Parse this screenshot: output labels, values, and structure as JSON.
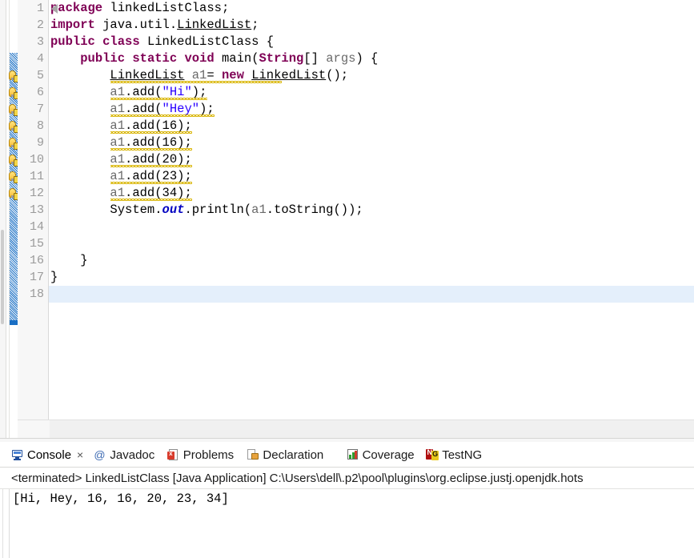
{
  "editor": {
    "first_line": 1,
    "last_line": 18,
    "current_line": 18,
    "line_numbers": [
      "1",
      "2",
      "3",
      "4",
      "5",
      "6",
      "7",
      "8",
      "9",
      "10",
      "11",
      "12",
      "13",
      "14",
      "15",
      "16",
      "17",
      "18"
    ],
    "fold_marker_line": 4,
    "fold_marker_icon": "collapse-minus-icon",
    "change_bar_color": "#1a6fc4",
    "warning_icon": "warning-lightbulb-icon",
    "warning_lines": [
      5,
      6,
      7,
      8,
      9,
      10,
      11,
      12
    ],
    "lines": [
      {
        "n": 1,
        "code": "package linkedListClass;"
      },
      {
        "n": 2,
        "code": "import java.util.LinkedList;"
      },
      {
        "n": 3,
        "code": "public class LinkedListClass {"
      },
      {
        "n": 4,
        "code": "    public static void main(String[] args) {"
      },
      {
        "n": 5,
        "code": "        LinkedList a1= new LinkedList();"
      },
      {
        "n": 6,
        "code": "        a1.add(\"Hi\");"
      },
      {
        "n": 7,
        "code": "        a1.add(\"Hey\");"
      },
      {
        "n": 8,
        "code": "        a1.add(16);"
      },
      {
        "n": 9,
        "code": "        a1.add(16);"
      },
      {
        "n": 10,
        "code": "        a1.add(20);"
      },
      {
        "n": 11,
        "code": "        a1.add(23);"
      },
      {
        "n": 12,
        "code": "        a1.add(34);"
      },
      {
        "n": 13,
        "code": "        System.out.println(a1.toString());"
      },
      {
        "n": 14,
        "code": ""
      },
      {
        "n": 15,
        "code": ""
      },
      {
        "n": 16,
        "code": "    }"
      },
      {
        "n": 17,
        "code": "}"
      },
      {
        "n": 18,
        "code": ""
      }
    ],
    "syntax_colors": {
      "keyword": "#7f0055",
      "string": "#2a00ff",
      "local_variable": "#6a6a6a",
      "static_field": "#0000c0",
      "plain": "#000000",
      "warning_squiggle": "#d8b400",
      "current_line_highlight": "#e4effb"
    },
    "scroll_left_arrow": "scroll-left-arrow-icon"
  },
  "console_view": {
    "tabs": [
      {
        "label": "Console",
        "icon": "console-monitor-icon",
        "active": true,
        "closable": true
      },
      {
        "label": "Javadoc",
        "icon": "javadoc-at-icon",
        "active": false,
        "closable": false
      },
      {
        "label": "Problems",
        "icon": "problems-error-icon",
        "active": false,
        "closable": false
      },
      {
        "label": "Declaration",
        "icon": "declaration-icon",
        "active": false,
        "closable": false
      },
      {
        "label": "Coverage",
        "icon": "coverage-chart-icon",
        "active": false,
        "closable": false
      },
      {
        "label": "TestNG",
        "icon": "testng-logo-icon",
        "active": false,
        "closable": false
      }
    ],
    "close_glyph": "×",
    "launch_line": "<terminated> LinkedListClass [Java Application] C:\\Users\\dell\\.p2\\pool\\plugins\\org.eclipse.justj.openjdk.hots",
    "output": "[Hi, Hey, 16, 16, 20, 23, 34]"
  }
}
